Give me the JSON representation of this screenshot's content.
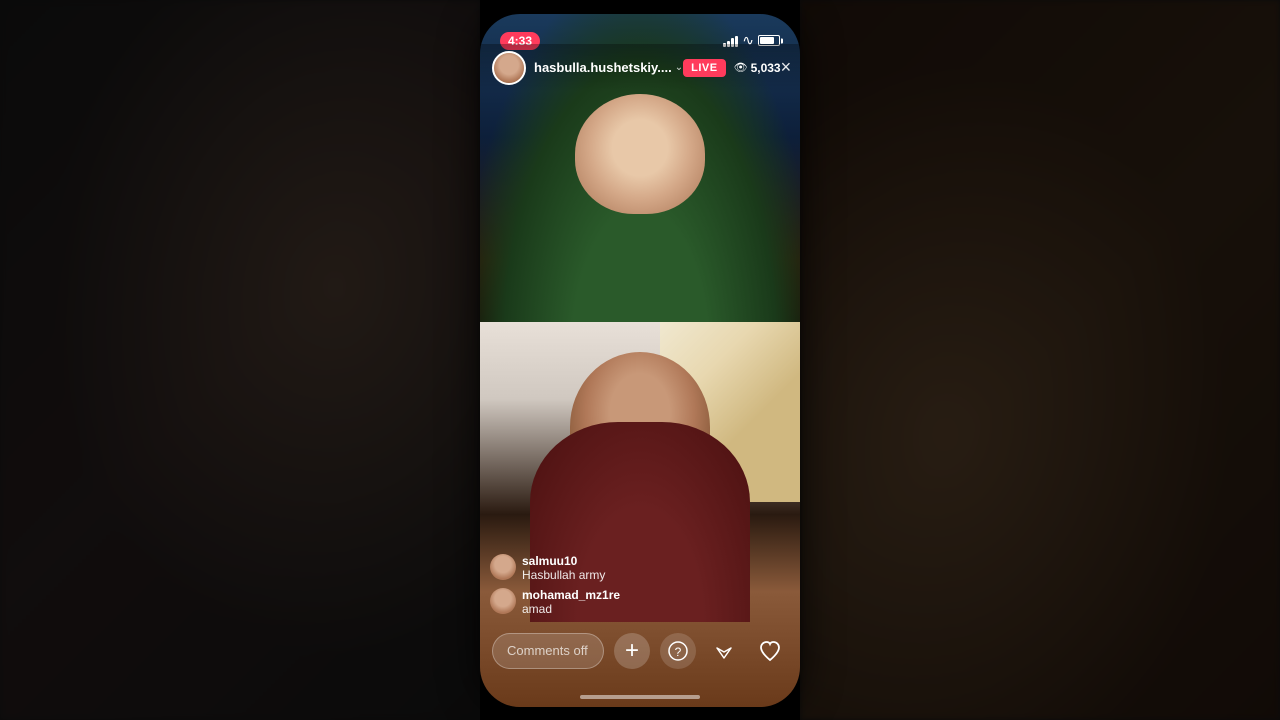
{
  "statusBar": {
    "time": "4:33",
    "viewerCount": "5,033"
  },
  "header": {
    "username": "hasbulla.hushetskiy....",
    "liveBadge": "LIVE",
    "closeIcon": "×"
  },
  "comments": [
    {
      "username": "salmuu10",
      "message": "Hasbullah army"
    },
    {
      "username": "mohamad_mz1re",
      "message": "amad"
    }
  ],
  "actionBar": {
    "commentPlaceholder": "Comments off",
    "addIcon": "+",
    "questionIcon": "?",
    "sendIcon": "▽",
    "heartIcon": "♡"
  },
  "colors": {
    "liveBadge": "#ff3b5c",
    "timeBackground": "#ff3b5c",
    "textWhite": "#ffffff"
  }
}
